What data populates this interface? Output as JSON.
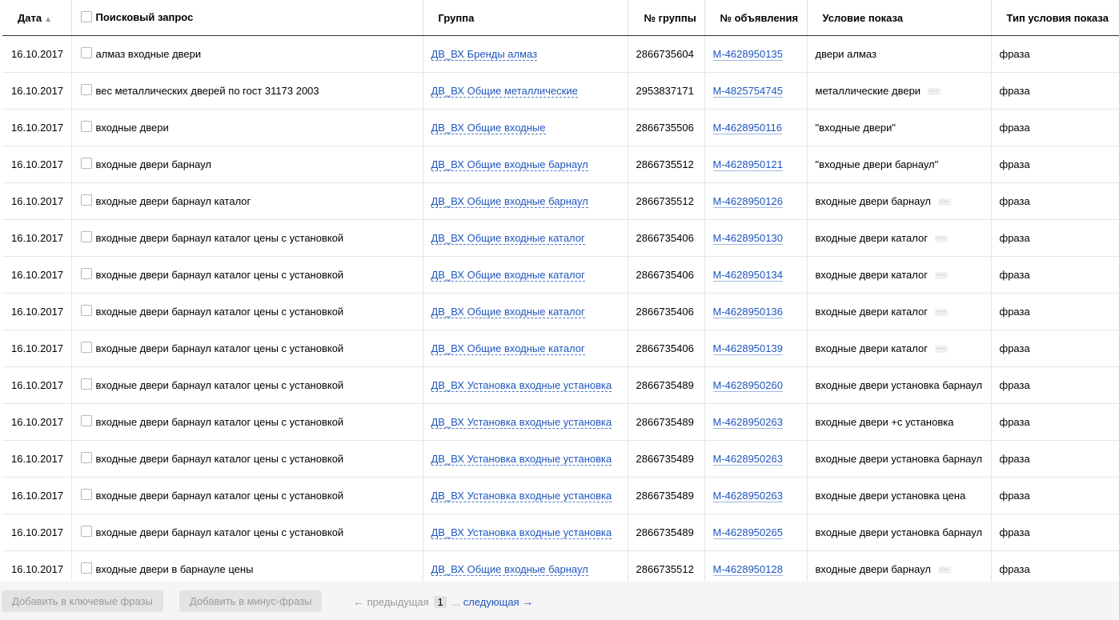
{
  "columns": {
    "date": "Дата",
    "sort_indicator": "▲",
    "query": "Поисковый запрос",
    "group": "Группа",
    "group_number": "№ группы",
    "ad_number": "№ объявления",
    "condition": "Условие показа",
    "condition_type": "Тип условия показа"
  },
  "more_glyph": "···",
  "rows": [
    {
      "date": "16.10.2017",
      "query": "алмаз входные двери",
      "group": "ДВ_ВХ Бренды алмаз",
      "group_number": "2866735604",
      "ad_number": "M-4628950135",
      "condition": "двери алмаз",
      "has_more": false,
      "condition_type": "фраза"
    },
    {
      "date": "16.10.2017",
      "query": "вес металлических дверей по гост 31173 2003",
      "group": "ДВ_ВХ Общие металлические",
      "group_number": "2953837171",
      "ad_number": "M-4825754745",
      "condition": "металлические двери",
      "has_more": true,
      "condition_type": "фраза"
    },
    {
      "date": "16.10.2017",
      "query": "входные двери",
      "group": "ДВ_ВХ Общие входные",
      "group_number": "2866735506",
      "ad_number": "M-4628950116",
      "condition": "\"входные двери\"",
      "has_more": false,
      "condition_type": "фраза"
    },
    {
      "date": "16.10.2017",
      "query": "входные двери барнаул",
      "group": "ДВ_ВХ Общие входные барнаул",
      "group_number": "2866735512",
      "ad_number": "M-4628950121",
      "condition": "\"входные двери барнаул\"",
      "has_more": false,
      "condition_type": "фраза"
    },
    {
      "date": "16.10.2017",
      "query": "входные двери барнаул каталог",
      "group": "ДВ_ВХ Общие входные барнаул",
      "group_number": "2866735512",
      "ad_number": "M-4628950126",
      "condition": "входные двери барнаул",
      "has_more": true,
      "condition_type": "фраза"
    },
    {
      "date": "16.10.2017",
      "query": "входные двери барнаул каталог цены с установкой",
      "group": "ДВ_ВХ Общие входные каталог",
      "group_number": "2866735406",
      "ad_number": "M-4628950130",
      "condition": "входные двери каталог",
      "has_more": true,
      "condition_type": "фраза"
    },
    {
      "date": "16.10.2017",
      "query": "входные двери барнаул каталог цены с установкой",
      "group": "ДВ_ВХ Общие входные каталог",
      "group_number": "2866735406",
      "ad_number": "M-4628950134",
      "condition": "входные двери каталог",
      "has_more": true,
      "condition_type": "фраза"
    },
    {
      "date": "16.10.2017",
      "query": "входные двери барнаул каталог цены с установкой",
      "group": "ДВ_ВХ Общие входные каталог",
      "group_number": "2866735406",
      "ad_number": "M-4628950136",
      "condition": "входные двери каталог",
      "has_more": true,
      "condition_type": "фраза"
    },
    {
      "date": "16.10.2017",
      "query": "входные двери барнаул каталог цены с установкой",
      "group": "ДВ_ВХ Общие входные каталог",
      "group_number": "2866735406",
      "ad_number": "M-4628950139",
      "condition": "входные двери каталог",
      "has_more": true,
      "condition_type": "фраза"
    },
    {
      "date": "16.10.2017",
      "query": "входные двери барнаул каталог цены с установкой",
      "group": "ДВ_ВХ Установка входные установка",
      "group_number": "2866735489",
      "ad_number": "M-4628950260",
      "condition": "входные двери установка барнаул",
      "has_more": false,
      "condition_type": "фраза"
    },
    {
      "date": "16.10.2017",
      "query": "входные двери барнаул каталог цены с установкой",
      "group": "ДВ_ВХ Установка входные установка",
      "group_number": "2866735489",
      "ad_number": "M-4628950263",
      "condition": "входные двери +с установка",
      "has_more": false,
      "condition_type": "фраза"
    },
    {
      "date": "16.10.2017",
      "query": "входные двери барнаул каталог цены с установкой",
      "group": "ДВ_ВХ Установка входные установка",
      "group_number": "2866735489",
      "ad_number": "M-4628950263",
      "condition": "входные двери установка барнаул",
      "has_more": false,
      "condition_type": "фраза"
    },
    {
      "date": "16.10.2017",
      "query": "входные двери барнаул каталог цены с установкой",
      "group": "ДВ_ВХ Установка входные установка",
      "group_number": "2866735489",
      "ad_number": "M-4628950263",
      "condition": "входные двери установка цена",
      "has_more": false,
      "condition_type": "фраза"
    },
    {
      "date": "16.10.2017",
      "query": "входные двери барнаул каталог цены с установкой",
      "group": "ДВ_ВХ Установка входные установка",
      "group_number": "2866735489",
      "ad_number": "M-4628950265",
      "condition": "входные двери установка барнаул",
      "has_more": false,
      "condition_type": "фраза"
    },
    {
      "date": "16.10.2017",
      "query": "входные двери в барнауле цены",
      "group": "ДВ_ВХ Общие входные барнаул",
      "group_number": "2866735512",
      "ad_number": "M-4628950128",
      "condition": "входные двери барнаул",
      "has_more": true,
      "condition_type": "фраза"
    }
  ],
  "footer": {
    "add_keywords_label": "Добавить в ключевые фразы",
    "add_minus_label": "Добавить в минус-фразы",
    "prev_arrow": "←",
    "prev_label": "предыдущая",
    "current_page": "1",
    "ellipsis": "...",
    "next_label": "следующая",
    "next_arrow": "→"
  }
}
